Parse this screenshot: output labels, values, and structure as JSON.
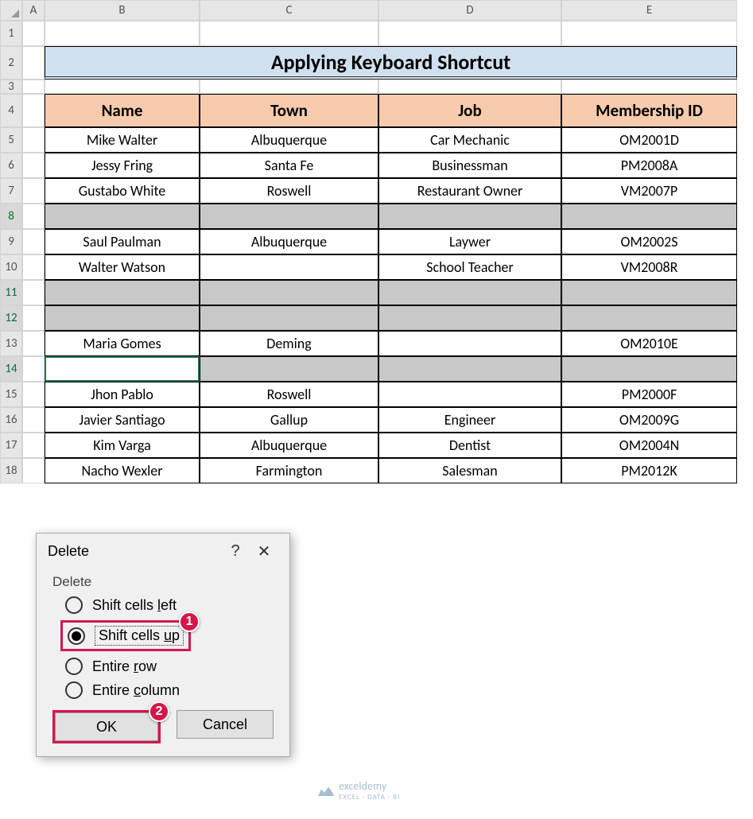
{
  "columns": [
    "A",
    "B",
    "C",
    "D",
    "E"
  ],
  "rows": [
    "1",
    "2",
    "3",
    "4",
    "5",
    "6",
    "7",
    "8",
    "9",
    "10",
    "11",
    "12",
    "13",
    "14",
    "15",
    "16",
    "17",
    "18"
  ],
  "selected_rows": [
    "8",
    "11",
    "12",
    "14"
  ],
  "title": "Applying Keyboard Shortcut",
  "headers": {
    "name": "Name",
    "town": "Town",
    "job": "Job",
    "mid": "Membership ID"
  },
  "data": [
    {
      "name": "Mike Walter",
      "town": "Albuquerque",
      "job": "Car Mechanic",
      "mid": "OM2001D"
    },
    {
      "name": "Jessy Fring",
      "town": "Santa Fe",
      "job": "Businessman",
      "mid": "PM2008A"
    },
    {
      "name": "Gustabo White",
      "town": "Roswell",
      "job": "Restaurant Owner",
      "mid": "VM2007P"
    },
    {
      "name": "",
      "town": "",
      "job": "",
      "mid": ""
    },
    {
      "name": "Saul Paulman",
      "town": "Albuquerque",
      "job": "Laywer",
      "mid": "OM2002S"
    },
    {
      "name": "Walter Watson",
      "town": "",
      "job": "School Teacher",
      "mid": "VM2008R"
    },
    {
      "name": "",
      "town": "",
      "job": "",
      "mid": ""
    },
    {
      "name": "",
      "town": "",
      "job": "",
      "mid": ""
    },
    {
      "name": "Maria Gomes",
      "town": "Deming",
      "job": "",
      "mid": "OM2010E"
    },
    {
      "name": "",
      "town": "",
      "job": "",
      "mid": ""
    },
    {
      "name": "Jhon Pablo",
      "town": "Roswell",
      "job": "",
      "mid": "PM2000F"
    },
    {
      "name": "Javier Santiago",
      "town": "Gallup",
      "job": "Engineer",
      "mid": "OM2009G"
    },
    {
      "name": "Kim Varga",
      "town": "Albuquerque",
      "job": "Dentist",
      "mid": "OM2004N"
    },
    {
      "name": "Nacho Wexler",
      "town": "Farmington",
      "job": "Salesman",
      "mid": "PM2012K"
    }
  ],
  "dialog": {
    "title": "Delete",
    "group": "Delete",
    "opts": {
      "left_pre": "Shift cells ",
      "left_u": "l",
      "left_post": "eft",
      "up_pre": "Shift cells ",
      "up_u": "u",
      "up_post": "p",
      "row_pre": "Entire ",
      "row_u": "r",
      "row_post": "ow",
      "col_pre": "Entire ",
      "col_u": "c",
      "col_post": "olumn"
    },
    "ok": "OK",
    "cancel": "Cancel",
    "callouts": {
      "one": "1",
      "two": "2"
    }
  },
  "watermark": {
    "brand": "exceldemy",
    "tag": "EXCEL · DATA · BI"
  }
}
